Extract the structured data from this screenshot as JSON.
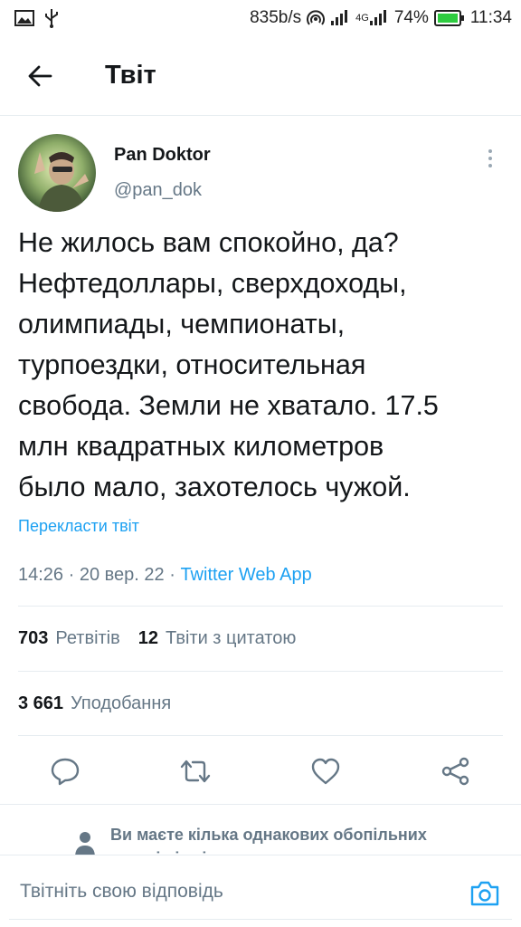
{
  "status_bar": {
    "net_speed": "835b/s",
    "network_label": "4G",
    "battery": "74%",
    "time": "11:34",
    "icons_left": [
      "image-icon",
      "usb-icon"
    ],
    "icons_right": [
      "wifi-hotspot-icon",
      "signal-icon",
      "signal-4g-icon",
      "battery-icon"
    ]
  },
  "header": {
    "title": "Твіт",
    "back_icon": "arrow-left-icon"
  },
  "tweet": {
    "author": {
      "display_name": "Pan Doktor",
      "handle": "@pan_dok"
    },
    "text_lines": [
      "Не жилось вам спокойно, да?",
      "Нефтедоллары, сверхдоходы,",
      "олимпиады, чемпионаты,",
      "турпоездки, относительная",
      "свобода. Земли не хватало. 17.5",
      "млн квадратных километров",
      "было мало, захотелось чужой."
    ],
    "translate_label": "Перекласти твіт",
    "time": "14:26",
    "date": "20 вер. 22",
    "separator": " · ",
    "source": "Twitter Web App",
    "retweets_count": "703",
    "retweets_label": "Ретвітів",
    "quotes_count": "12",
    "quotes_label": "Твіти з цитатою",
    "likes_count": "3 661",
    "likes_label": "Уподобання"
  },
  "actions": [
    "reply-icon",
    "retweet-icon",
    "like-icon",
    "share-icon"
  ],
  "suggestion": {
    "text": "Ви маєте кілька однакових обопільних читачів із цією людиною"
  },
  "reply_bar": {
    "placeholder": "Твітніть свою відповідь"
  },
  "colors": {
    "accent": "#1da1f2",
    "secondary_text": "#657786",
    "primary_text": "#14171a",
    "divider": "#e6ecf0"
  }
}
